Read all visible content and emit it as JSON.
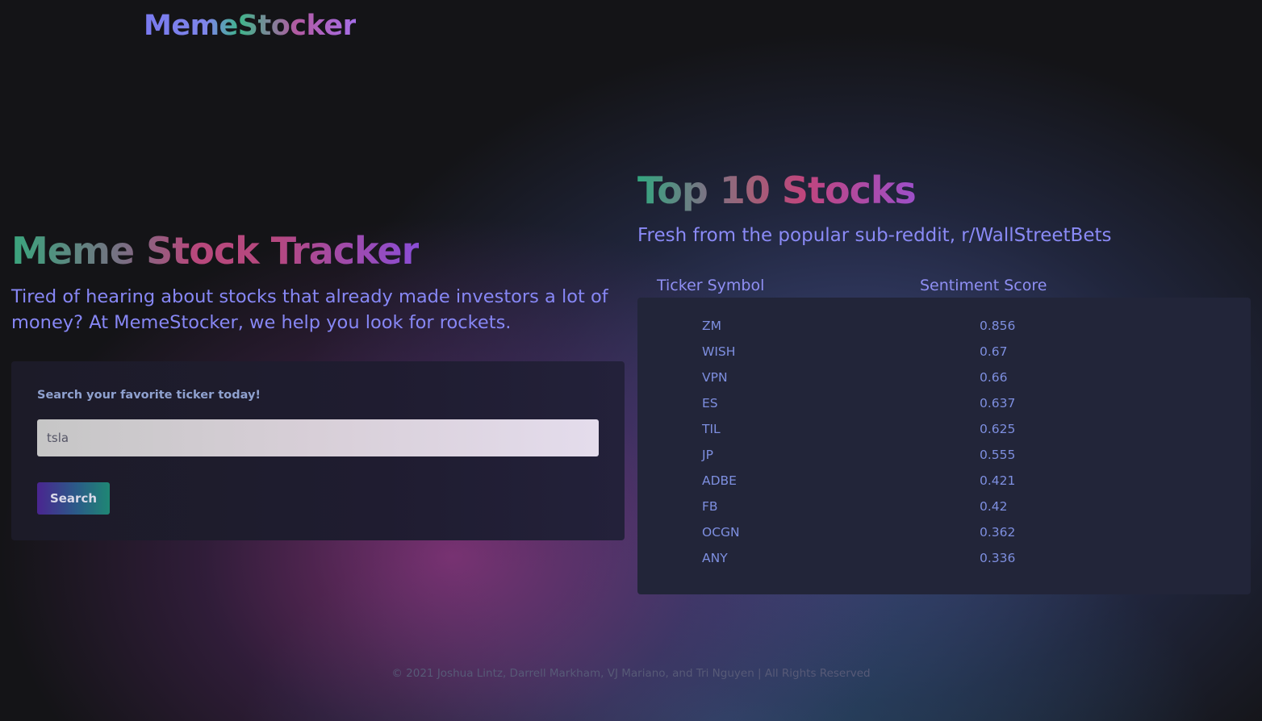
{
  "header": {
    "logo_text": "MemeStocker"
  },
  "hero": {
    "title": "Meme Stock Tracker",
    "subtitle": "Tired of hearing about stocks that already made investors a lot of money? At MemeStocker, we help you look for rockets."
  },
  "search": {
    "label": "Search your favorite ticker today!",
    "input_value": "tsla",
    "button_label": "Search"
  },
  "top_stocks": {
    "title": "Top 10 Stocks",
    "subtitle": "Fresh from the popular sub-reddit, r/WallStreetBets",
    "columns": [
      "Ticker Symbol",
      "Sentiment Score"
    ],
    "rows": [
      {
        "ticker": "ZM",
        "score": "0.856"
      },
      {
        "ticker": "WISH",
        "score": "0.67"
      },
      {
        "ticker": "VPN",
        "score": "0.66"
      },
      {
        "ticker": "ES",
        "score": "0.637"
      },
      {
        "ticker": "TIL",
        "score": "0.625"
      },
      {
        "ticker": "JP",
        "score": "0.555"
      },
      {
        "ticker": "ADBE",
        "score": "0.421"
      },
      {
        "ticker": "FB",
        "score": "0.42"
      },
      {
        "ticker": "OCGN",
        "score": "0.362"
      },
      {
        "ticker": "ANY",
        "score": "0.336"
      }
    ]
  },
  "footer": {
    "text": "© 2021 Joshua Lintz, Darrell Markham, VJ Mariano, and Tri Nguyen | All Rights Reserved"
  },
  "colors": {
    "background": "#141417",
    "accent_text": "#8787f5",
    "card": "#222539",
    "gradient_green": "#3aa57d",
    "gradient_pink": "#c0457d",
    "gradient_purple": "#9d4fc9"
  }
}
